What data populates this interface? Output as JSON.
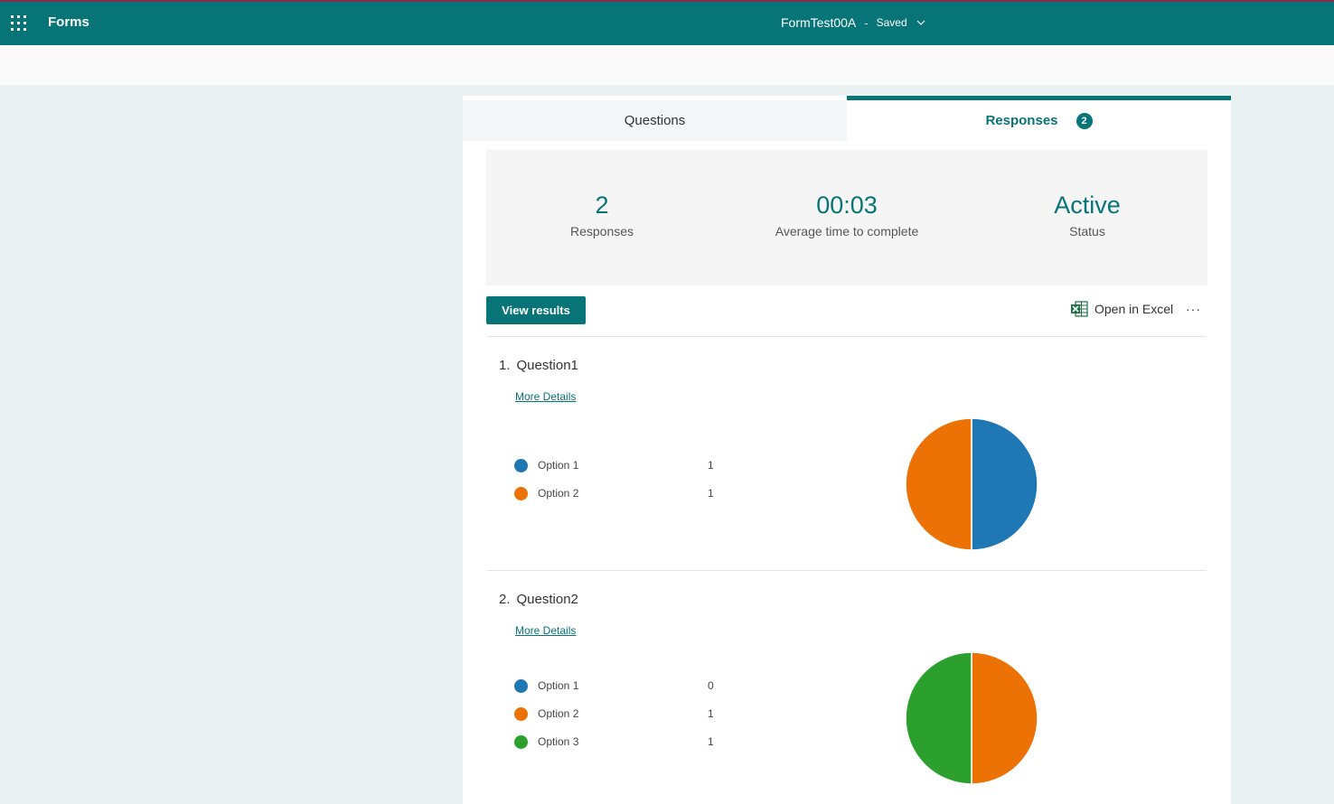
{
  "topbar": {
    "app_name": "Forms",
    "doc_title": "FormTest00A",
    "separator": "-",
    "save_status": "Saved"
  },
  "tabs": {
    "questions_label": "Questions",
    "responses_label": "Responses",
    "responses_count": "2"
  },
  "summary": {
    "responses_value": "2",
    "responses_label": "Responses",
    "avg_time_value": "00:03",
    "avg_time_label": "Average time to complete",
    "status_value": "Active",
    "status_label": "Status"
  },
  "actions": {
    "view_results": "View results",
    "open_excel": "Open in Excel",
    "more": "···"
  },
  "colors": {
    "accent": "#077478",
    "option1": "#1f77b4",
    "option2": "#ed7205",
    "option3": "#2ca02c"
  },
  "questions": [
    {
      "number": "1.",
      "title": "Question1",
      "more_details": "More Details",
      "options": [
        {
          "label": "Option 1",
          "count": "1",
          "color": "#1f77b4"
        },
        {
          "label": "Option 2",
          "count": "1",
          "color": "#ed7205"
        }
      ]
    },
    {
      "number": "2.",
      "title": "Question2",
      "more_details": "More Details",
      "options": [
        {
          "label": "Option 1",
          "count": "0",
          "color": "#1f77b4"
        },
        {
          "label": "Option 2",
          "count": "1",
          "color": "#ed7205"
        },
        {
          "label": "Option 3",
          "count": "1",
          "color": "#2ca02c"
        }
      ]
    }
  ]
}
